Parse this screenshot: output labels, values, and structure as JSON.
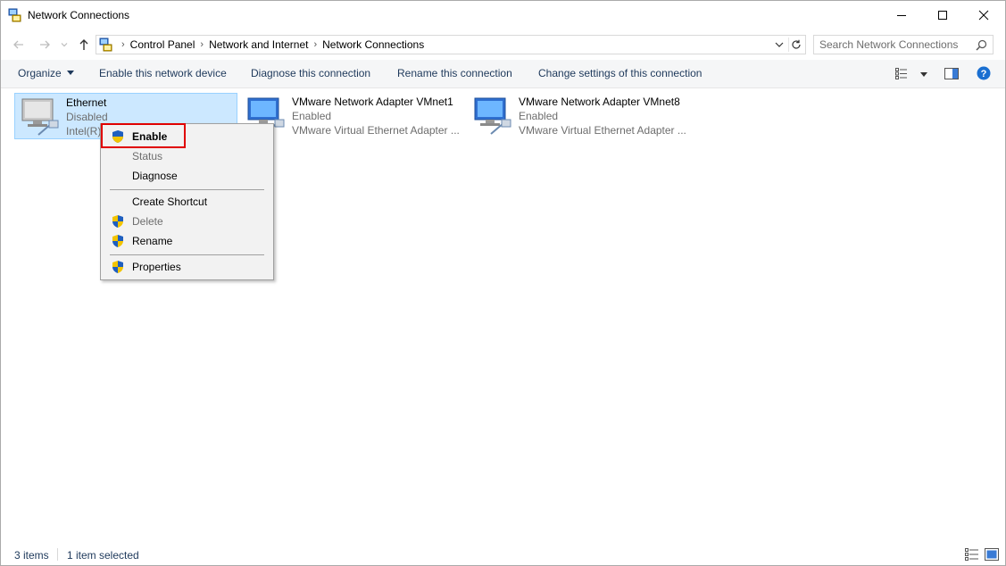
{
  "window": {
    "title": "Network Connections",
    "minimize_icon": "minimize-icon",
    "maximize_icon": "maximize-icon",
    "close_icon": "close-icon"
  },
  "navigation": {
    "back_icon": "arrow-left-icon",
    "forward_icon": "arrow-right-icon",
    "recent_icon": "chevron-down-icon",
    "up_icon": "arrow-up-icon",
    "breadcrumbs": [
      "Control Panel",
      "Network and Internet",
      "Network Connections"
    ],
    "refresh_icon": "refresh-icon"
  },
  "search": {
    "placeholder": "Search Network Connections"
  },
  "toolbar": {
    "organize": "Organize",
    "enable_device": "Enable this network device",
    "diagnose": "Diagnose this connection",
    "rename": "Rename this connection",
    "change_settings": "Change settings of this connection",
    "help_icon": "help-icon"
  },
  "connections": [
    {
      "name": "Ethernet",
      "status": "Disabled",
      "device": "Intel(R)"
    },
    {
      "name": "VMware Network Adapter VMnet1",
      "status": "Enabled",
      "device": "VMware Virtual Ethernet Adapter ..."
    },
    {
      "name": "VMware Network Adapter VMnet8",
      "status": "Enabled",
      "device": "VMware Virtual Ethernet Adapter ..."
    }
  ],
  "context_menu": {
    "enable": "Enable",
    "status": "Status",
    "diagnose": "Diagnose",
    "create_shortcut": "Create Shortcut",
    "delete": "Delete",
    "rename": "Rename",
    "properties": "Properties"
  },
  "statusbar": {
    "items_count": "3 items",
    "selected_count": "1 item selected"
  },
  "colors": {
    "selection_bg": "#cce8ff",
    "highlight_border": "#e00000",
    "link_text": "#1e395b"
  }
}
